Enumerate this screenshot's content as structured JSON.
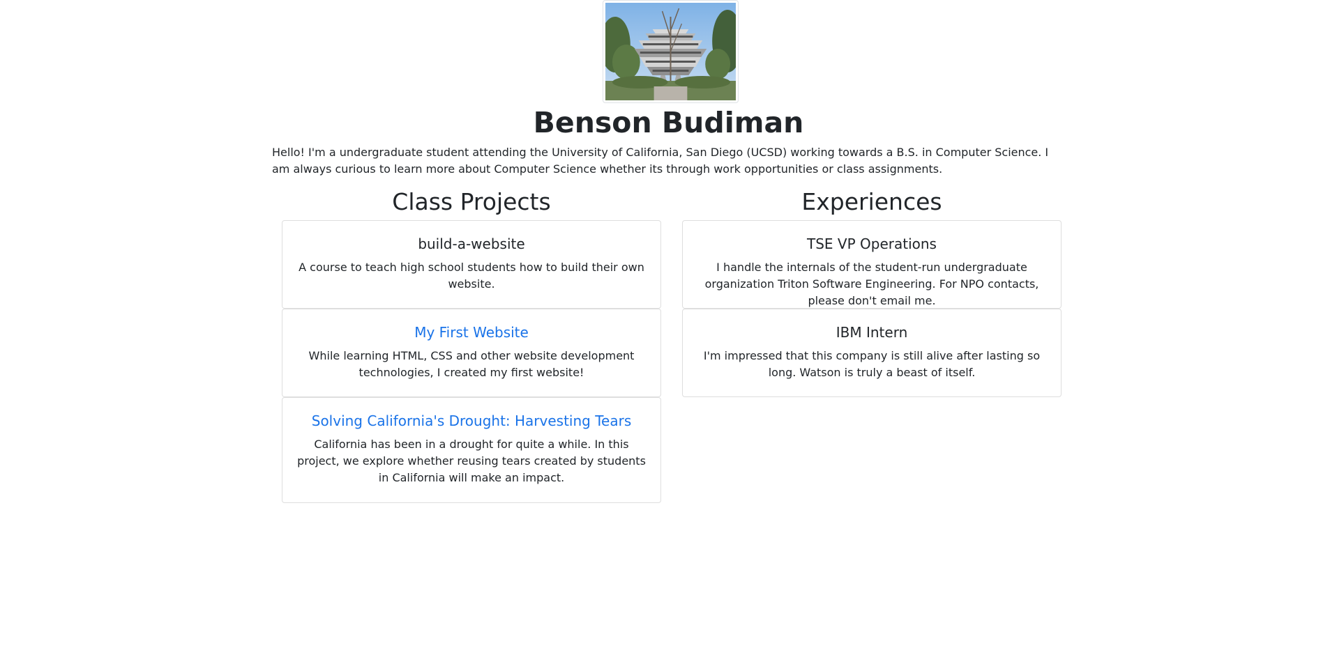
{
  "profile": {
    "photo_alt": "Geisel Library",
    "name": "Benson Budiman",
    "intro": "Hello! I'm a undergraduate student attending the University of California, San Diego (UCSD) working towards a B.S. in Computer Science. I am always curious to learn more about Computer Science whether its through work opportunities or class assignments."
  },
  "projects": {
    "heading": "Class Projects",
    "items": [
      {
        "title": "build-a-website",
        "description": "A course to teach high school students how to build their own website.",
        "link": false
      },
      {
        "title": "My First Website",
        "description": "While learning HTML, CSS and other website development technologies, I created my first website!",
        "link": true
      },
      {
        "title": "Solving California's Drought: Harvesting Tears",
        "description": "California has been in a drought for quite a while. In this project, we explore whether reusing tears created by students in California will make an impact.",
        "link": true
      }
    ]
  },
  "experiences": {
    "heading": "Experiences",
    "items": [
      {
        "title": "TSE VP Operations",
        "description": "I handle the internals of the student-run undergraduate organization Triton Software Engineering. For NPO contacts, please don't email me."
      },
      {
        "title": "IBM Intern",
        "description": "I'm impressed that this company is still alive after lasting so long. Watson is truly a beast of itself."
      }
    ]
  },
  "colors": {
    "text": "#212529",
    "link": "#1a73e8",
    "card_border": "#dcdcdc"
  }
}
